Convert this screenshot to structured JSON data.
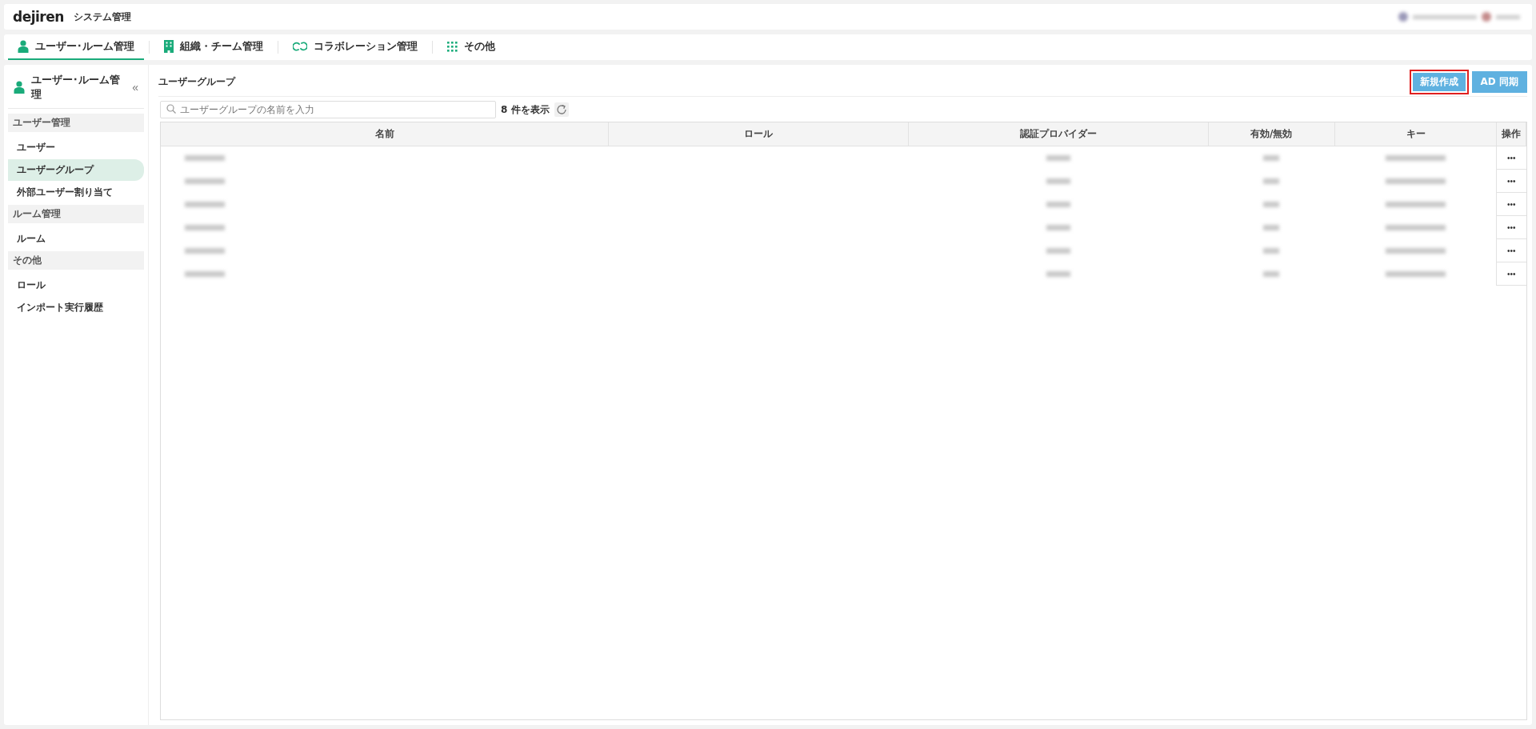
{
  "header": {
    "logo": "dejiren",
    "title": "システム管理"
  },
  "tabs": [
    {
      "label": "ユーザー･ルーム管理",
      "selected": true
    },
    {
      "label": "組織・チーム管理",
      "selected": false
    },
    {
      "label": "コラボレーション管理",
      "selected": false
    },
    {
      "label": "その他",
      "selected": false
    }
  ],
  "sidebar": {
    "title": "ユーザー･ルーム管理",
    "collapse": "«",
    "sections": [
      {
        "heading": "ユーザー管理",
        "items": [
          {
            "label": "ユーザー",
            "selected": false
          },
          {
            "label": "ユーザーグループ",
            "selected": true
          },
          {
            "label": "外部ユーザー割り当て",
            "selected": false
          }
        ]
      },
      {
        "heading": "ルーム管理",
        "items": [
          {
            "label": "ルーム",
            "selected": false
          }
        ]
      },
      {
        "heading": "その他",
        "items": [
          {
            "label": "ロール",
            "selected": false
          },
          {
            "label": "インポート実行履歴",
            "selected": false
          }
        ]
      }
    ]
  },
  "page": {
    "title": "ユーザーグループ",
    "buttons": [
      {
        "label": "新規作成",
        "highlighted": true
      },
      {
        "label": "AD 同期",
        "highlighted": false
      }
    ]
  },
  "search": {
    "placeholder": "ユーザーグループの名前を入力"
  },
  "count": "8 件を表示",
  "table": {
    "columns": [
      "名前",
      "ロール",
      "認証プロバイダー",
      "有効/無効",
      "キー",
      "操作"
    ],
    "rows": [
      {
        "actions": "•••"
      },
      {
        "actions": "•••"
      },
      {
        "actions": "•••"
      },
      {
        "actions": "•••"
      },
      {
        "actions": "•••"
      },
      {
        "actions": "•••"
      }
    ]
  }
}
